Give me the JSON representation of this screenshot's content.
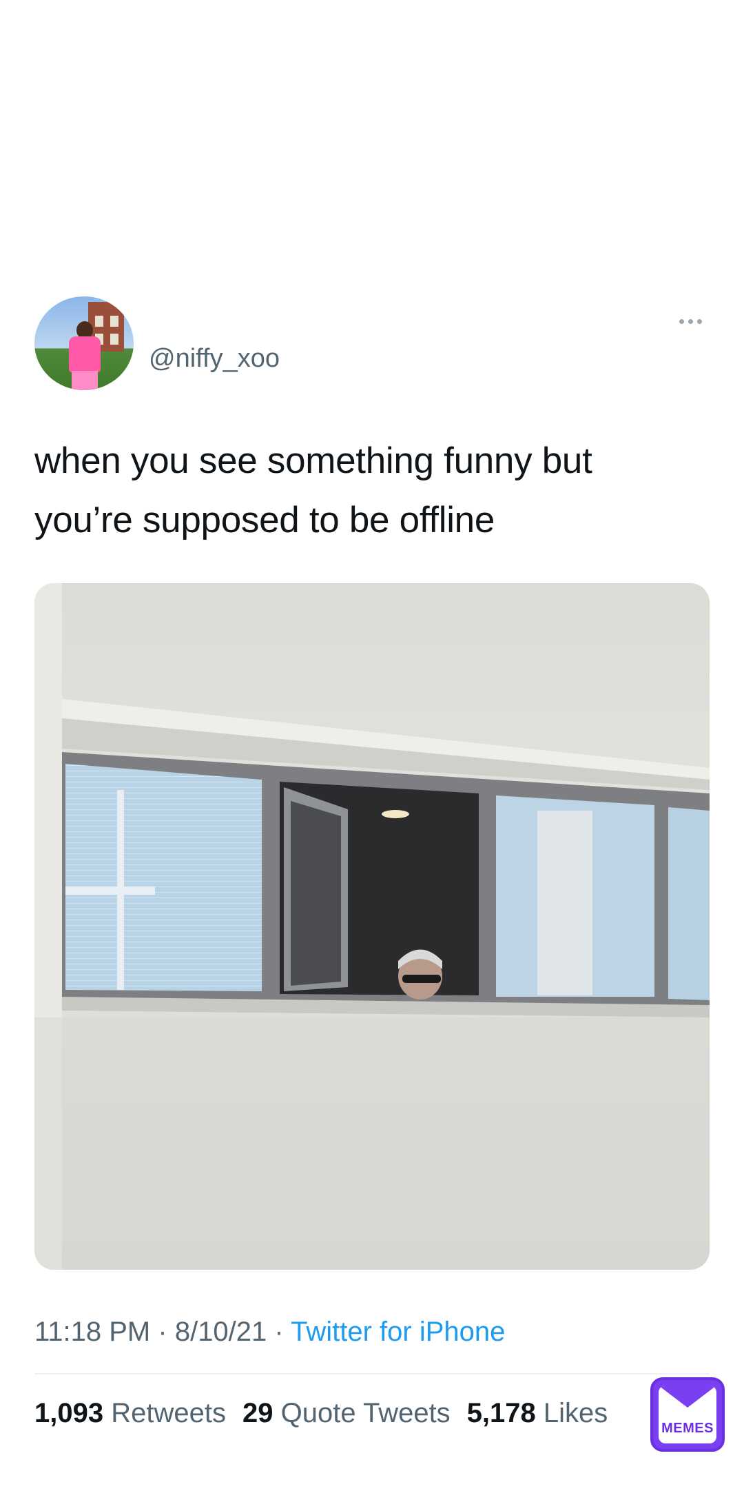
{
  "tweet": {
    "handle": "@niffy_xoo",
    "text_line1": "when you see something funny but",
    "text_line2": "you’re supposed to be offline",
    "time": "11:18 PM",
    "date": "8/10/21",
    "separator": "·",
    "source": "Twitter for iPhone"
  },
  "stats": {
    "retweets_count": "1,093",
    "retweets_label": "Retweets",
    "quotes_count": "29",
    "quotes_label": "Quote Tweets",
    "likes_count": "5,178",
    "likes_label": "Likes"
  },
  "watermark": {
    "label": "MEMES",
    "color": "#7b3ff2"
  },
  "colors": {
    "secondary_text": "#536471",
    "link": "#1d9bf0",
    "primary_text": "#0f1419"
  },
  "icons": {
    "more": "more-horizontal-icon"
  }
}
